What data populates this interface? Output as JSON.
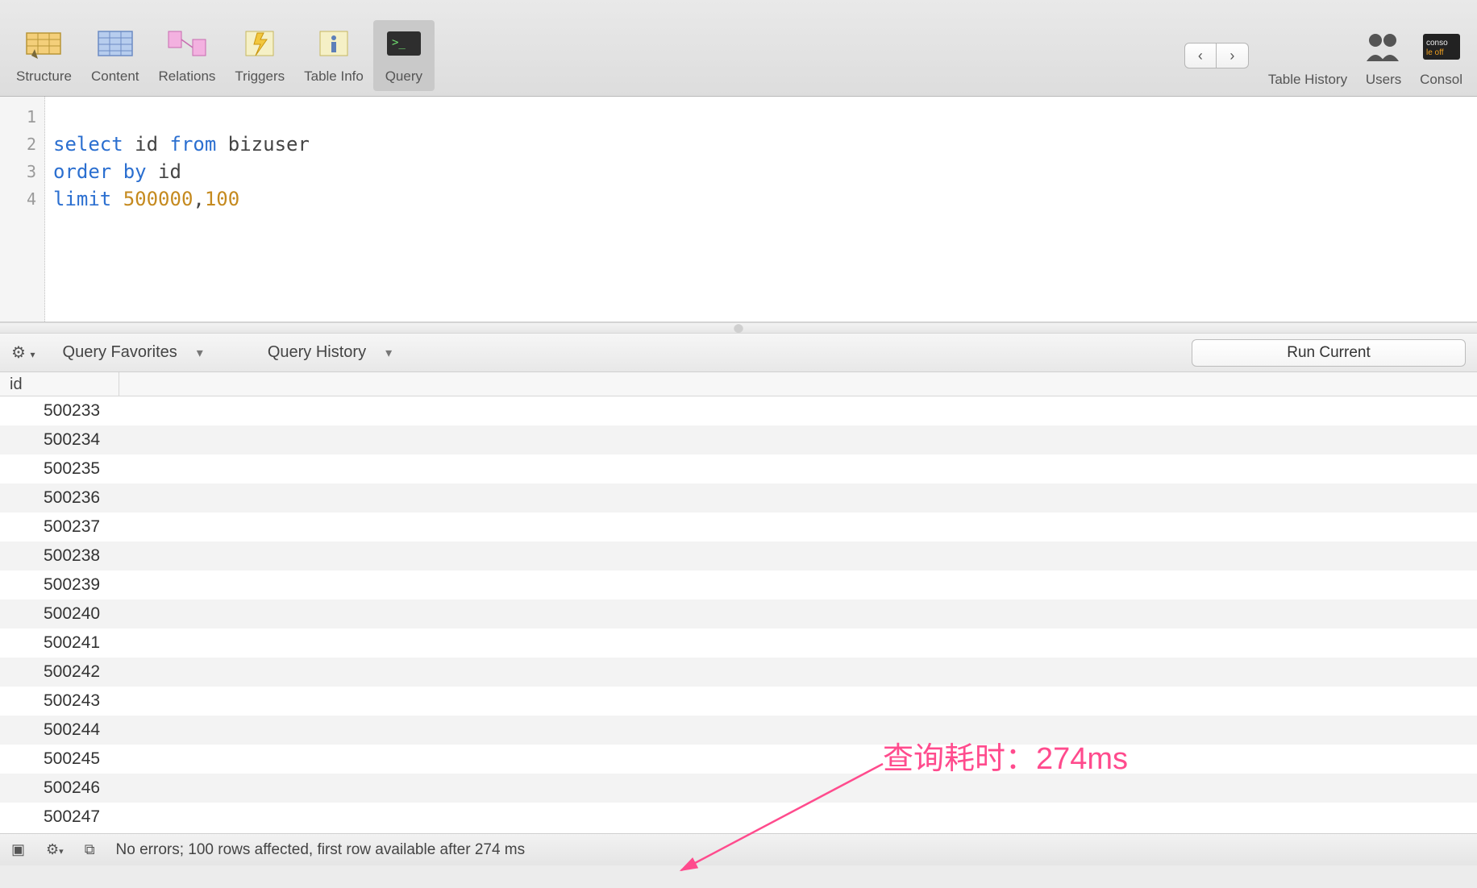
{
  "toolbar": {
    "tabs": [
      {
        "name": "structure",
        "label": "Structure"
      },
      {
        "name": "content",
        "label": "Content"
      },
      {
        "name": "relations",
        "label": "Relations"
      },
      {
        "name": "triggers",
        "label": "Triggers"
      },
      {
        "name": "tableinfo",
        "label": "Table Info"
      },
      {
        "name": "query",
        "label": "Query",
        "active": true
      }
    ],
    "right": [
      {
        "name": "table-history",
        "label": "Table History"
      },
      {
        "name": "users",
        "label": "Users"
      },
      {
        "name": "console",
        "label": "Consol"
      }
    ]
  },
  "editor": {
    "line_numbers": [
      "1",
      "2",
      "3",
      "4"
    ],
    "lines": [
      {
        "tokens": []
      },
      {
        "tokens": [
          {
            "t": "kw",
            "v": "select"
          },
          {
            "t": "sp",
            "v": " "
          },
          {
            "t": "ident",
            "v": "id"
          },
          {
            "t": "sp",
            "v": " "
          },
          {
            "t": "kw",
            "v": "from"
          },
          {
            "t": "sp",
            "v": " "
          },
          {
            "t": "ident",
            "v": "bizuser"
          }
        ]
      },
      {
        "tokens": [
          {
            "t": "kw",
            "v": "order by"
          },
          {
            "t": "sp",
            "v": " "
          },
          {
            "t": "ident",
            "v": "id"
          }
        ]
      },
      {
        "tokens": [
          {
            "t": "kw",
            "v": "limit"
          },
          {
            "t": "sp",
            "v": " "
          },
          {
            "t": "num",
            "v": "500000"
          },
          {
            "t": "ident",
            "v": ","
          },
          {
            "t": "num",
            "v": "100"
          }
        ]
      }
    ]
  },
  "midbar": {
    "favorites_label": "Query Favorites",
    "history_label": "Query History",
    "run_label": "Run Current"
  },
  "results": {
    "column": "id",
    "rows": [
      "500233",
      "500234",
      "500235",
      "500236",
      "500237",
      "500238",
      "500239",
      "500240",
      "500241",
      "500242",
      "500243",
      "500244",
      "500245",
      "500246",
      "500247"
    ]
  },
  "status": {
    "text": "No errors; 100 rows affected, first row available after 274 ms"
  },
  "annotation": {
    "text": "查询耗时：274ms"
  }
}
